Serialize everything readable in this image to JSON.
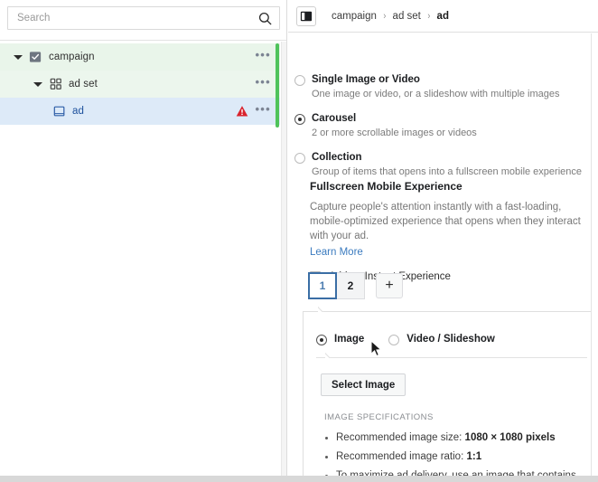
{
  "left_panel": {
    "search": {
      "placeholder": "Search",
      "value": "",
      "icon": "search-icon"
    },
    "tree": [
      {
        "label": "campaign",
        "level": "campaign",
        "icon": "campaign-checkbox-icon",
        "expanded": true,
        "selected": false,
        "menu": "•••",
        "warning": false
      },
      {
        "label": "ad set",
        "level": "adset",
        "icon": "ad-set-grid-icon",
        "expanded": true,
        "selected": false,
        "menu": "•••",
        "warning": false
      },
      {
        "label": "ad",
        "level": "ad",
        "icon": "ad-square-icon",
        "expanded": false,
        "selected": true,
        "menu": "•••",
        "warning": true
      }
    ],
    "accent_color": "#4fc35b"
  },
  "right_panel": {
    "toggle_icon": "sidebar-panel-toggle-icon",
    "breadcrumb": {
      "items": [
        "campaign",
        "ad set",
        "ad"
      ],
      "separator": "›",
      "current": "ad"
    },
    "formats": [
      {
        "title": "Single Image or Video",
        "description": "One image or video, or a slideshow with multiple images",
        "selected": false
      },
      {
        "title": "Carousel",
        "description": "2 or more scrollable images or videos",
        "selected": true
      },
      {
        "title": "Collection",
        "description": "Group of items that opens into a fullscreen mobile experience",
        "selected": false
      }
    ],
    "fullscreen_section": {
      "title": "Fullscreen Mobile Experience",
      "body": "Capture people's attention instantly with a fast-loading, mobile-optimized experience that opens when they interact with your ad.",
      "learn_more": "Learn More",
      "checkbox_label": "Add an Instant Experience",
      "checkbox_checked": false
    },
    "card_tabs": {
      "tabs": [
        {
          "label": "1",
          "active": true
        },
        {
          "label": "2",
          "active": false
        }
      ],
      "add_label": "+",
      "active_color": "#3a6ea5"
    },
    "creative": {
      "types": [
        {
          "label": "Image",
          "selected": true
        },
        {
          "label": "Video / Slideshow",
          "selected": false
        }
      ],
      "select_image_button": "Select Image"
    },
    "specs": {
      "heading": "IMAGE SPECIFICATIONS",
      "items": [
        {
          "prefix": "Recommended image size: ",
          "strong": "1080 × 1080 pixels",
          "suffix": ""
        },
        {
          "prefix": "Recommended image ratio: ",
          "strong": "1:1",
          "suffix": ""
        },
        {
          "prefix": "To maximize ad delivery, use an image that contains",
          "strong": "",
          "suffix": ""
        }
      ]
    }
  }
}
